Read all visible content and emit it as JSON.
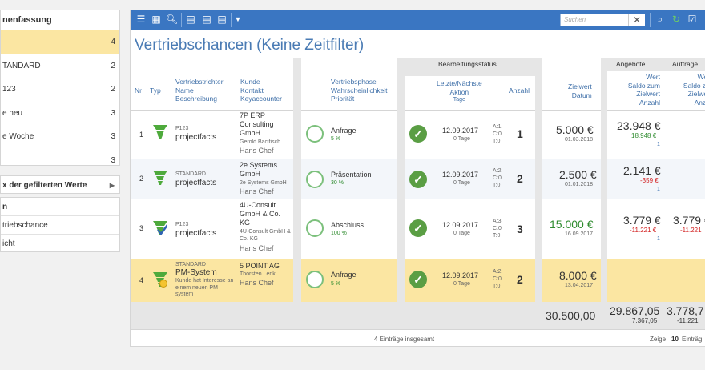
{
  "sidebar": {
    "summary_header": "nenfassung",
    "items": [
      {
        "label": "",
        "count": "4"
      },
      {
        "label": "TANDARD",
        "count": "2"
      },
      {
        "label": "123",
        "count": "2"
      },
      {
        "label": "e neu",
        "count": "3"
      },
      {
        "label": "e Woche",
        "count": "3"
      },
      {
        "label": "",
        "count": "3"
      }
    ],
    "filtered_values": "x der gefilterten Werte",
    "section2_header": "n",
    "links": [
      "triebschance",
      "icht"
    ]
  },
  "toolbar": {
    "search_placeholder": "Suchen"
  },
  "title": "Vertriebschancen (Keine Zeitfilter)",
  "headers": {
    "bearbeitungsstatus": "Bearbeitungsstatus",
    "angebote": "Angebote",
    "auftraege": "Aufträge",
    "nr": "Nr",
    "typ": "Typ",
    "vertriebstrichter": [
      "Vertriebstrichter",
      "Name",
      "Beschreibung"
    ],
    "kunde": [
      "Kunde",
      "Kontakt",
      "Keyaccounter"
    ],
    "phase": [
      "Vertriebsphase",
      "Wahrscheinlichkeit",
      "Priorität"
    ],
    "aktion": [
      "Letzte/Nächste",
      "Aktion",
      "Tage"
    ],
    "anzahl": "Anzahl",
    "zielwert": [
      "Zielwert",
      "Datum"
    ],
    "angebote_cols": [
      "Wert",
      "Saldo zum",
      "Zielwert",
      "Anzahl"
    ],
    "auftraege_cols": [
      "Wer",
      "Saldo zu",
      "Zielwer",
      "Anza"
    ]
  },
  "rows": [
    {
      "nr": "1",
      "funnel_small": "P123",
      "funnel_name": "projectfacts",
      "funnel_desc": "",
      "kunde": "7P ERP Consulting GmbH",
      "kontakt": "Gerold Bacifisch",
      "keyacc": "Hans Chef",
      "phase": "Anfrage",
      "prob": "5 %",
      "date": "12.09.2017",
      "days": "0 Tage",
      "acd": [
        "A:1",
        "C:0",
        "T:0"
      ],
      "anzahl": "1",
      "ziel": "5.000 €",
      "ziel_date": "01.03.2018",
      "ang_wert": "23.948 €",
      "ang_saldo": "18.948 €",
      "ang_anz": "1",
      "auf_wert": "",
      "auf_saldo": ""
    },
    {
      "nr": "2",
      "funnel_small": "STANDARD",
      "funnel_name": "projectfacts",
      "funnel_desc": "",
      "kunde": "2e Systems GmbH",
      "kontakt": "2e Systems GmbH",
      "keyacc": "Hans Chef",
      "phase": "Präsentation",
      "prob": "30 %",
      "date": "12.09.2017",
      "days": "0 Tage",
      "acd": [
        "A:2",
        "C:0",
        "T:0"
      ],
      "anzahl": "2",
      "ziel": "2.500 €",
      "ziel_date": "01.01.2018",
      "ang_wert": "2.141 €",
      "ang_saldo": "-359 €",
      "ang_anz": "1",
      "auf_wert": "",
      "auf_saldo": ""
    },
    {
      "nr": "3",
      "funnel_small": "P123",
      "funnel_name": "projectfacts",
      "funnel_desc": "",
      "kunde": "4U-Consult GmbH & Co. KG",
      "kontakt": "4U-Consult GmbH & Co. KG",
      "keyacc": "Hans Chef",
      "phase": "Abschluss",
      "prob": "100 %",
      "date": "12.09.2017",
      "days": "0 Tage",
      "acd": [
        "A:3",
        "C:0",
        "T:0"
      ],
      "anzahl": "3",
      "ziel": "15.000 €",
      "ziel_date": "16.09.2017",
      "ang_wert": "3.779 €",
      "ang_saldo": "-11.221 €",
      "ang_anz": "1",
      "auf_wert": "3.779 €",
      "auf_saldo": "-11.221"
    },
    {
      "nr": "4",
      "funnel_small": "STANDARD",
      "funnel_name": "PM-System",
      "funnel_desc": "Kunde hat Interesse an einem neuen PM system",
      "kunde": "5 POINT AG",
      "kontakt": "Thorsten Lenk",
      "keyacc": "Hans Chef",
      "phase": "Anfrage",
      "prob": "5 %",
      "date": "12.09.2017",
      "days": "0 Tage",
      "acd": [
        "A:2",
        "C:0",
        "T:0"
      ],
      "anzahl": "2",
      "ziel": "8.000 €",
      "ziel_date": "13.04.2017",
      "ang_wert": "",
      "ang_saldo": "",
      "ang_anz": "",
      "auf_wert": "",
      "auf_saldo": ""
    }
  ],
  "totals": {
    "ziel": "30.500,00",
    "ang": "29.867,05",
    "ang_saldo": "7.367,05",
    "auf": "3.778,7",
    "auf_saldo": "-11.221,"
  },
  "footer": {
    "count": "4 Einträge insgesamt",
    "zeige": "Zeige",
    "n": "10",
    "eintr": "Einträg"
  },
  "colors": {
    "accent": "#3a76c2",
    "selected_row": "#fbe6a2",
    "green": "#2e8b2e",
    "red": "#d21f1f"
  }
}
